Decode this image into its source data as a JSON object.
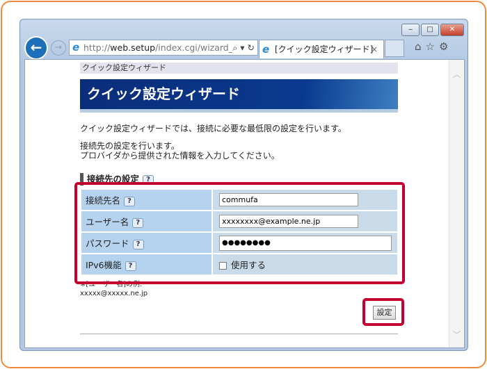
{
  "browser": {
    "url_prefix": "http://",
    "url_host": "web.setup",
    "url_path": "/index.cgi/wizard_",
    "tab_title": "[クイック設定ウィザード]",
    "tab_close": "×",
    "minimize": "‒",
    "maximize": "□",
    "close": "✕",
    "back": "←",
    "forward": "→",
    "search_glyph": "⌕ ▾ ↻",
    "tools": "⌂☆⚙"
  },
  "page": {
    "breadcrumb": "クイック設定ウィザード",
    "title": "クイック設定ウィザード",
    "intro": "クイック設定ウィザードでは、接続に必要な最低限の設定を行います。",
    "instruction1": "接続先の設定を行います。",
    "instruction2": "プロバイダから提供された情報を入力してください。",
    "section_title": "接続先の設定",
    "help": "?",
    "fields": [
      {
        "label": "接続先名",
        "value": "commufa"
      },
      {
        "label": "ユーザー名",
        "value": "xxxxxxxx@example.ne.jp"
      },
      {
        "label": "パスワード",
        "value": "●●●●●●●●"
      },
      {
        "label": "IPv6機能",
        "checkbox_label": "使用する",
        "checked": false
      }
    ],
    "note1": "※[ユーザー名]の例:",
    "note2": "xxxxx@xxxxx.ne.jp",
    "submit": "設定"
  },
  "colors": {
    "highlight": "#c3002f",
    "banner": "#0a3a8e",
    "frame": "#f08a3c"
  }
}
